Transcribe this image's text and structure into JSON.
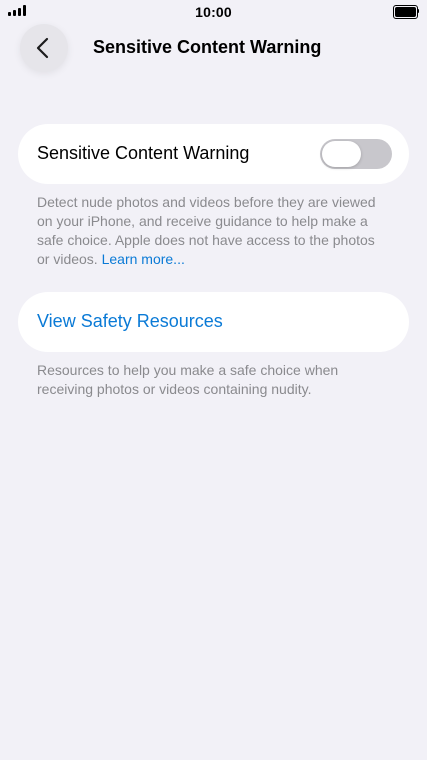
{
  "status_bar": {
    "time": "10:00"
  },
  "nav": {
    "back_icon": "chevron-left-icon",
    "title": "Sensitive Content Warning"
  },
  "toggle_section": {
    "label": "Sensitive Content Warning",
    "enabled": false,
    "footer_text": "Detect nude photos and videos before they are viewed on your iPhone, and receive guidance to help make a safe choice. Apple does not have access to the photos or videos.",
    "learn_more": "Learn more..."
  },
  "resources_section": {
    "link_label": "View Safety Resources",
    "footer_text": "Resources to help you make a safe choice when receiving photos or videos containing nudity."
  },
  "colors": {
    "background": "#F2F1F7",
    "card": "#FFFFFF",
    "link": "#0A7AD6",
    "secondary_text": "#8A8A8E",
    "switch_off": "#C8C7CC"
  }
}
